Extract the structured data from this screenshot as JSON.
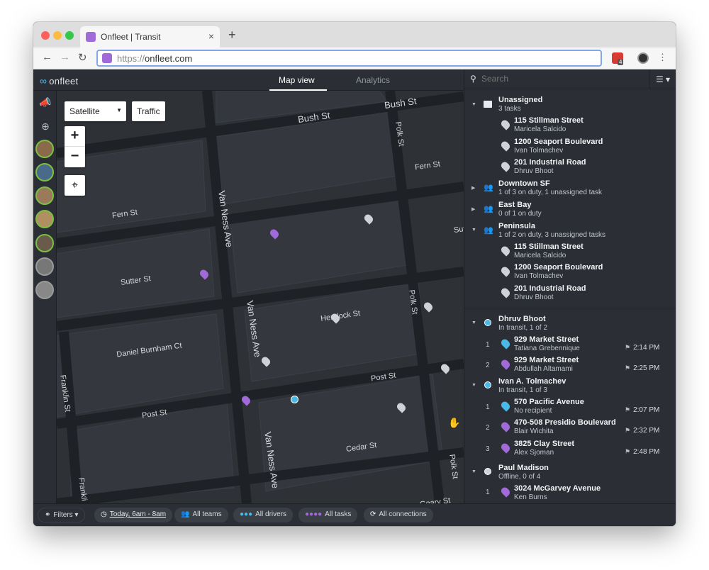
{
  "browser": {
    "tab_title": "Onfleet | Transit",
    "new_tab": "+",
    "close": "×",
    "url_scheme": "https://",
    "url_host": "onfleet.com",
    "ext_count": "4"
  },
  "app": {
    "logo": "onfleet",
    "tabs": [
      {
        "label": "Map view",
        "active": true
      },
      {
        "label": "Analytics",
        "active": false
      }
    ]
  },
  "map": {
    "satellite_label": "Satellite",
    "traffic_label": "Traffic",
    "zoom_in": "+",
    "zoom_out": "−",
    "streets": [
      "Bush St",
      "Bush St",
      "Polk St",
      "Fern St",
      "Fern St",
      "Sut",
      "Van Ness Ave",
      "Sutter St",
      "Hemlock St",
      "Polk St",
      "Daniel Burnham Ct",
      "Van Ness Ave",
      "Post St",
      "Franklin St",
      "Post St",
      "Van Ness Ave",
      "Cedar St",
      "Polk St",
      "Frankli",
      "Geary St"
    ]
  },
  "bottombar": {
    "filters": "Filters",
    "date_range": "Today, 6am - 8am",
    "teams": "All teams",
    "drivers": "All drivers",
    "tasks": "All tasks",
    "connections": "All connections"
  },
  "panel": {
    "search_placeholder": "Search",
    "unassigned": {
      "title": "Unassigned",
      "subtitle": "3 tasks",
      "tasks": [
        {
          "address": "115 Stillman Street",
          "name": "Maricela Salcido"
        },
        {
          "address": "1200 Seaport Boulevard",
          "name": "Ivan Tolmachev"
        },
        {
          "address": "201 Industrial Road",
          "name": "Dhruv Bhoot"
        }
      ]
    },
    "teams": [
      {
        "title": "Downtown SF",
        "subtitle": "1 of 3 on duty, 1 unassigned task"
      },
      {
        "title": "East Bay",
        "subtitle": "0 of 1 on duty"
      },
      {
        "title": "Peninsula",
        "subtitle": "1 of 2 on duty, 3 unassigned tasks"
      }
    ],
    "peninsula_tasks": [
      {
        "address": "115 Stillman Street",
        "name": "Maricela Salcido"
      },
      {
        "address": "1200 Seaport Boulevard",
        "name": "Ivan Tolmachev"
      },
      {
        "address": "201 Industrial Road",
        "name": "Dhruv Bhoot"
      }
    ],
    "drivers": [
      {
        "name": "Dhruv Bhoot",
        "status": "In transit, 1 of 2",
        "color": "#48b9e8",
        "tasks": [
          {
            "num": "1",
            "address": "929 Market Street",
            "name": "Tatiana Grebennique",
            "time": "2:14 PM"
          },
          {
            "num": "2",
            "address": "929 Market Street",
            "name": "Abdullah Altamami",
            "time": "2:25 PM"
          }
        ]
      },
      {
        "name": "Ivan A. Tolmachev",
        "status": "In transit, 1 of 3",
        "color": "#48b9e8",
        "tasks": [
          {
            "num": "1",
            "address": "570 Pacific Avenue",
            "name": "No recipient",
            "time": "2:07 PM"
          },
          {
            "num": "2",
            "address": "470-508 Presidio Boulevard",
            "name": "Blair Wichita",
            "time": "2:32 PM"
          },
          {
            "num": "3",
            "address": "3825 Clay Street",
            "name": "Alex Sjoman",
            "time": "2:48 PM"
          }
        ]
      },
      {
        "name": "Paul Madison",
        "status": "Offline, 0 of 4",
        "color": "#cfd3d7",
        "tasks": [
          {
            "num": "1",
            "address": "3024 McGarvey Avenue",
            "name": "Ken Burns",
            "time": ""
          }
        ]
      }
    ]
  }
}
